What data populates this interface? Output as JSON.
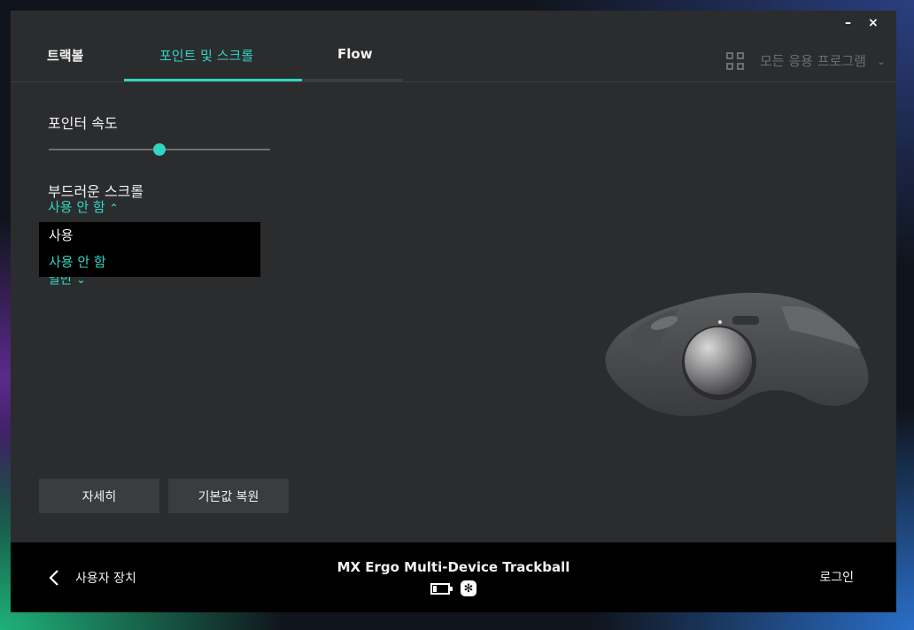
{
  "window": {
    "minimize_glyph": "–",
    "close_glyph": "×"
  },
  "tabs": [
    {
      "label": "트랙볼",
      "active": false
    },
    {
      "label": "포인트 및 스크롤",
      "active": true
    },
    {
      "label": "Flow",
      "active": false
    }
  ],
  "app_filter": {
    "icon": "grid-icon",
    "label": "모든 응용 프로그램"
  },
  "pointer_speed": {
    "label": "포인터 속도",
    "level": 0.5
  },
  "smooth_scroll": {
    "label": "부드러운 스크롤",
    "selected": "사용 안 함",
    "options": [
      "사용",
      "사용 안 함"
    ],
    "hidden_behind_text": "일반"
  },
  "buttons": {
    "details": "자세히",
    "restore_defaults": "기본값 복원"
  },
  "footer": {
    "back_label": "사용자 장치",
    "device_name": "MX Ergo Multi-Device Trackball",
    "battery_icon": "battery-low-icon",
    "connection_icon": "unifying-receiver-icon",
    "login_label": "로그인"
  },
  "colors": {
    "accent": "#2fd6c2",
    "panel": "#2b2c2e",
    "footer": "#000000"
  }
}
